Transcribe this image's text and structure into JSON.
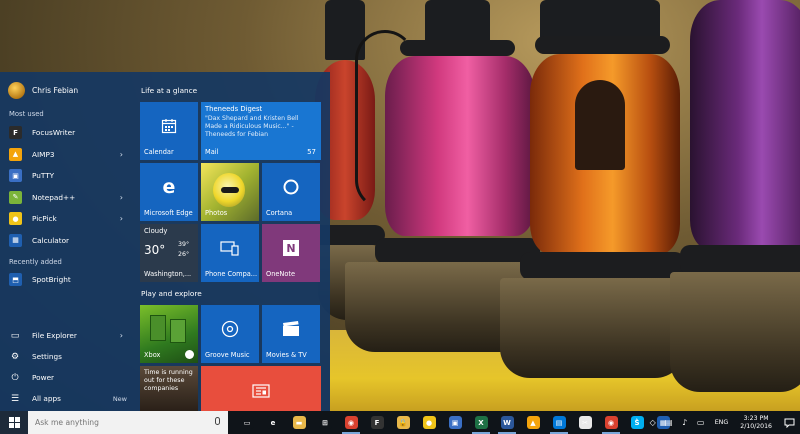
{
  "start_menu": {
    "user_name": "Chris Febian",
    "most_used_label": "Most used",
    "most_used": [
      {
        "label": "FocusWriter",
        "icon": "focuswriter-icon",
        "color": "#2b2b2b",
        "glyph": "F",
        "has_arrow": false
      },
      {
        "label": "AIMP3",
        "icon": "aimp-icon",
        "color": "#f4a40c",
        "glyph": "▲",
        "has_arrow": true
      },
      {
        "label": "PuTTY",
        "icon": "putty-icon",
        "color": "#3a6fc4",
        "glyph": "▣",
        "has_arrow": false
      },
      {
        "label": "Notepad++",
        "icon": "notepadpp-icon",
        "color": "#7bb43a",
        "glyph": "✎",
        "has_arrow": true
      },
      {
        "label": "PicPick",
        "icon": "picpick-icon",
        "color": "#f0c419",
        "glyph": "●",
        "has_arrow": true
      },
      {
        "label": "Calculator",
        "icon": "calculator-icon",
        "color": "#1f5fb0",
        "glyph": "▦",
        "has_arrow": false
      }
    ],
    "recently_added_label": "Recently added",
    "recently_added": [
      {
        "label": "SpotBright",
        "icon": "spotbright-icon",
        "color": "#1f5fb0",
        "glyph": "⬒"
      }
    ],
    "file_explorer_label": "File Explorer",
    "settings_label": "Settings",
    "power_label": "Power",
    "all_apps_label": "All apps",
    "new_label": "New"
  },
  "tiles": {
    "group1_title": "Life at a glance",
    "group2_title": "Play and explore",
    "calendar_label": "Calendar",
    "mail_title": "Theneeds Digest",
    "mail_body": "\"Dax Shepard and Kristen Bell Made a Ridiculous Music...\" - Theneeds for Febian",
    "mail_label": "Mail",
    "mail_count": "57",
    "edge_label": "Microsoft Edge",
    "photos_label": "Photos",
    "cortana_label": "Cortana",
    "weather_condition": "Cloudy",
    "weather_temp": "30°",
    "weather_high": "39°",
    "weather_low": "26°",
    "weather_location": "Washington,...",
    "phone_label": "Phone Compa...",
    "onenote_label": "OneNote",
    "xbox_label": "Xbox",
    "groove_label": "Groove Music",
    "movies_label": "Movies & TV",
    "news_text": "Time is running out for these companies"
  },
  "taskbar": {
    "search_placeholder": "Ask me anything",
    "apps": [
      {
        "name": "task-view-icon",
        "color": "#0f1419",
        "glyph": "▭",
        "active": false
      },
      {
        "name": "edge-icon",
        "color": "#0f1419",
        "glyph": "e",
        "active": false
      },
      {
        "name": "file-explorer-icon",
        "color": "#e8b84a",
        "glyph": "▬",
        "active": false
      },
      {
        "name": "store-icon",
        "color": "#0f1419",
        "glyph": "⊞",
        "active": false
      },
      {
        "name": "chrome-icon",
        "color": "#d9412f",
        "glyph": "◉",
        "active": true
      },
      {
        "name": "focuswriter-icon",
        "color": "#333333",
        "glyph": "F",
        "active": false
      },
      {
        "name": "keepass-icon",
        "color": "#e8b84a",
        "glyph": "🔒",
        "active": false
      },
      {
        "name": "picpick-icon",
        "color": "#f0c419",
        "glyph": "●",
        "active": false
      },
      {
        "name": "putty-icon",
        "color": "#3a6fc4",
        "glyph": "▣",
        "active": false
      },
      {
        "name": "excel-icon",
        "color": "#1e7145",
        "glyph": "X",
        "active": true
      },
      {
        "name": "word-icon",
        "color": "#2b579a",
        "glyph": "W",
        "active": true
      },
      {
        "name": "aimp-icon",
        "color": "#f4a40c",
        "glyph": "▲",
        "active": false
      },
      {
        "name": "photos-app-icon",
        "color": "#0078d7",
        "glyph": "▤",
        "active": true
      },
      {
        "name": "snipping-icon",
        "color": "#e9e9e9",
        "glyph": "✂",
        "active": false
      },
      {
        "name": "chrome-icon-2",
        "color": "#d9412f",
        "glyph": "◉",
        "active": true
      },
      {
        "name": "skype-icon",
        "color": "#00aff0",
        "glyph": "S",
        "active": false
      },
      {
        "name": "calculator-icon",
        "color": "#1f5fb0",
        "glyph": "▦",
        "active": false
      }
    ],
    "language": "ENG",
    "time": "3:23 PM",
    "date": "2/10/2016"
  }
}
